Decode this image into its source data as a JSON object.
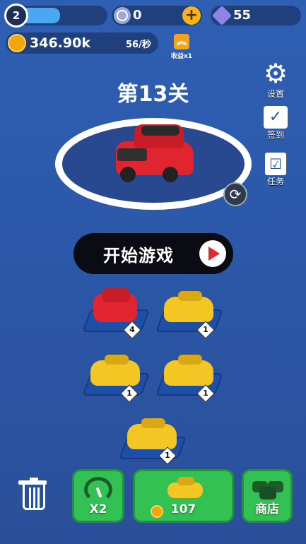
{
  "player": {
    "level": "2",
    "xp_progress": 0.42
  },
  "resources": {
    "currency_a": "0",
    "gems": "55",
    "coins": "346.90k",
    "rate": "56/秒",
    "income_label": "收益x1"
  },
  "level_title": "第13关",
  "side_menu": {
    "settings": "设置",
    "signin": "签到",
    "tasks": "任务"
  },
  "start_button": {
    "label": "开始游戏"
  },
  "cars": [
    {
      "color": "red",
      "level": "4"
    },
    {
      "color": "yellow",
      "level": "1"
    },
    {
      "color": "yellow",
      "level": "1"
    },
    {
      "color": "yellow",
      "level": "1"
    },
    {
      "color": "yellow",
      "level": "1"
    }
  ],
  "bottom": {
    "speed_label": "X2",
    "buy_price": "107",
    "shop_label": "商店"
  },
  "colors": {
    "green": "#33c154",
    "bg": "#2b58a8",
    "red": "#e8262f",
    "yellow": "#f3c624"
  }
}
